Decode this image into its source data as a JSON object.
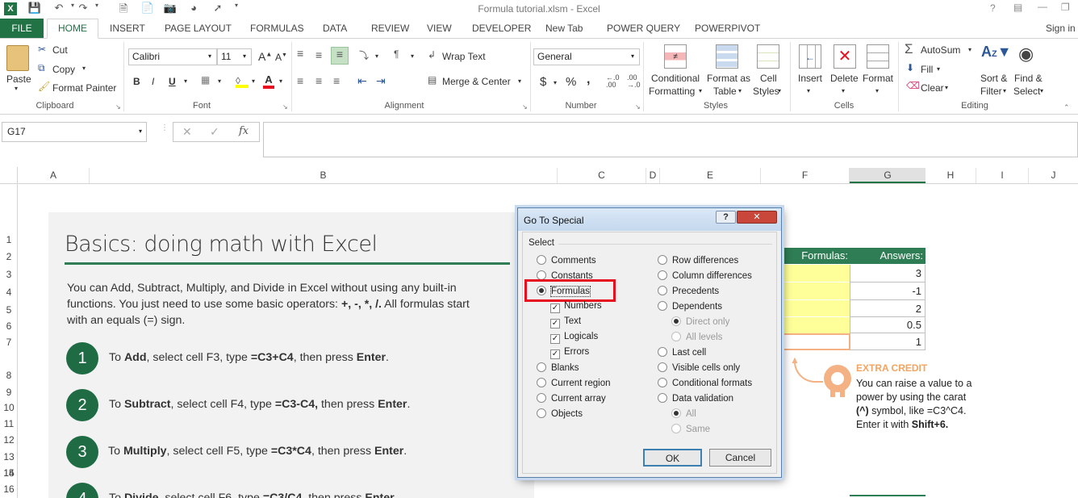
{
  "window": {
    "title": "Formula tutorial.xlsm - Excel",
    "help": "?",
    "signin": "Sign in"
  },
  "tabs": [
    "FILE",
    "HOME",
    "INSERT",
    "PAGE LAYOUT",
    "FORMULAS",
    "DATA",
    "REVIEW",
    "VIEW",
    "DEVELOPER",
    "New Tab",
    "POWER QUERY",
    "POWERPIVOT"
  ],
  "clipboard": {
    "paste": "Paste",
    "cut": "Cut",
    "copy": "Copy",
    "format_painter": "Format Painter",
    "label": "Clipboard"
  },
  "font": {
    "name": "Calibri",
    "size": "11",
    "bold": "B",
    "italic": "I",
    "underline": "U",
    "label": "Font"
  },
  "alignment": {
    "wrap": "Wrap Text",
    "merge": "Merge & Center",
    "label": "Alignment"
  },
  "number": {
    "format": "General",
    "currency": "$",
    "percent": "%",
    "comma": ",",
    "label": "Number"
  },
  "styles": {
    "conditional": "Conditional",
    "conditional2": "Formatting",
    "format_as": "Format as",
    "format_as2": "Table",
    "cell_styles": "Cell",
    "cell_styles2": "Styles",
    "label": "Styles"
  },
  "cells": {
    "insert": "Insert",
    "delete": "Delete",
    "format": "Format",
    "label": "Cells"
  },
  "editing": {
    "autosum": "AutoSum",
    "fill": "Fill",
    "clear": "Clear",
    "sort": "Sort &",
    "sort2": "Filter",
    "find": "Find &",
    "find2": "Select",
    "label": "Editing"
  },
  "formula_bar": {
    "name_box": "G17",
    "fx": "fx",
    "value": ""
  },
  "columns": [
    "A",
    "B",
    "C",
    "D",
    "E",
    "F",
    "G",
    "H",
    "I",
    "J"
  ],
  "rows": [
    "1",
    "2",
    "3",
    "4",
    "5",
    "6",
    "7",
    "8",
    "9",
    "10",
    "11",
    "12",
    "13",
    "14",
    "15",
    "16"
  ],
  "sheet": {
    "heading": "Basics: doing math with Excel",
    "intro1": "You can Add, Subtract, Multiply, and Divide in Excel without using any built-in",
    "intro2": "functions. You just need to use some basic operators: ",
    "ops": "+, -, *, /.",
    "intro3": " All formulas start",
    "intro4": "with an equals (=) sign.",
    "steps": [
      {
        "n": "1",
        "pre": "To ",
        "verb": "Add",
        "mid": ", select cell F3, type ",
        "formula": "=C3+C4",
        "post": ", then press ",
        "key": "Enter",
        "end": "."
      },
      {
        "n": "2",
        "pre": "To ",
        "verb": "Subtract",
        "mid": ", select cell F4, type ",
        "formula": "=C3-C4,",
        "post": " then press ",
        "key": "Enter",
        "end": "."
      },
      {
        "n": "3",
        "pre": "To ",
        "verb": "Multiply",
        "mid": ", select cell F5, type ",
        "formula": "=C3*C4",
        "post": ", then press ",
        "key": "Enter",
        "end": "."
      },
      {
        "n": "4",
        "pre": "To ",
        "verb": "Divide",
        "mid": ", select cell F6, type ",
        "formula": "=C3/C4",
        "post": ", then press ",
        "key": "Enter",
        "end": "."
      }
    ],
    "formulas_header": "Formulas:",
    "answers_header": "Answers:",
    "answers": [
      "3",
      "-1",
      "2",
      "0.5",
      "1"
    ],
    "extra_title": "EXTRA CREDIT",
    "extra1": "You can raise a value to a",
    "extra2": "power by using the carat",
    "extra3a": "(^)",
    "extra3b": " symbol, like =C3^C4.",
    "extra4a": "Enter it with ",
    "extra4b": "Shift+6."
  },
  "dialog": {
    "title": "Go To Special",
    "help": "?",
    "close": "✕",
    "group": "Select",
    "left": [
      "Comments",
      "Constants",
      "Formulas",
      "Numbers",
      "Text",
      "Logicals",
      "Errors",
      "Blanks",
      "Current region",
      "Current array",
      "Objects"
    ],
    "right": [
      "Row differences",
      "Column differences",
      "Precedents",
      "Dependents",
      "Direct only",
      "All levels",
      "Last cell",
      "Visible cells only",
      "Conditional formats",
      "Data validation",
      "All",
      "Same"
    ],
    "ok": "OK",
    "cancel": "Cancel"
  },
  "colors": {
    "excel_green": "#217346",
    "sheet_green": "#2e7d54",
    "highlight_red": "#e8101e",
    "yellow": "#ffff99",
    "orange": "#f4a460"
  }
}
